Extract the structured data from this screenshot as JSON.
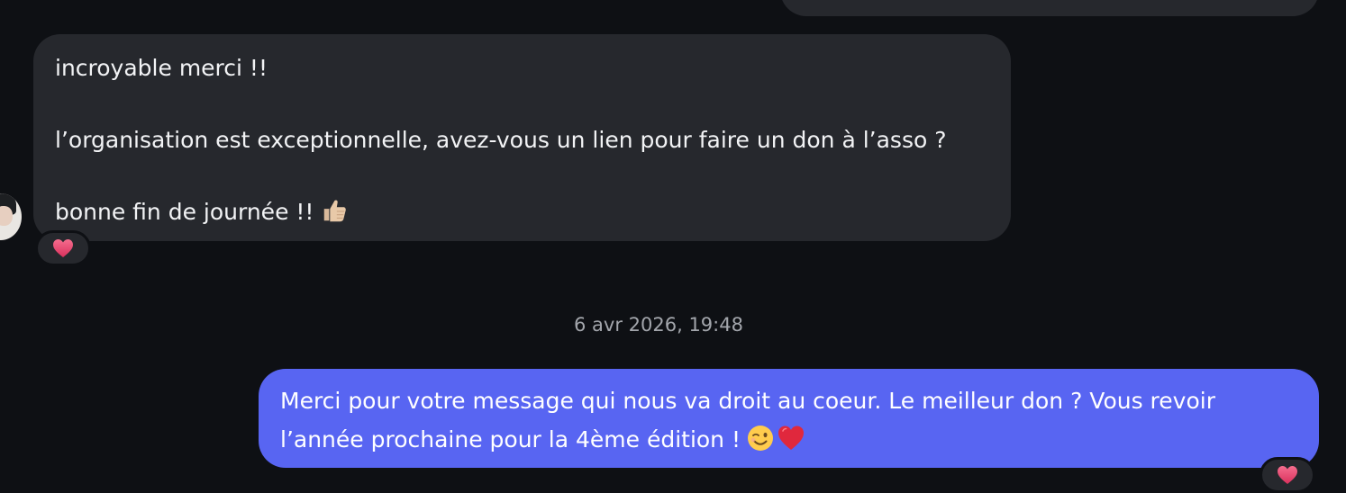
{
  "conversation": {
    "incoming_message": {
      "line1": "incroyable merci !!",
      "line2": "l’organisation est exceptionnelle, avez-vous un lien pour faire un don à l’asso ?",
      "line3": "bonne fin de journée !!",
      "emoji": "thumbs-up-icon",
      "reaction": "heart-icon"
    },
    "timestamp": "6 avr 2026, 19:48",
    "outgoing_message": {
      "line1": "Merci pour votre message qui nous va droit au coeur. Le meilleur don ? Vous revoir",
      "line2": "l’année prochaine pour la 4ème édition !",
      "emojis": [
        "wink-icon",
        "heart-icon"
      ],
      "reaction": "heart-icon"
    }
  },
  "colors": {
    "background": "#0e1014",
    "incoming_bubble": "#26282d",
    "outgoing_bubble": "#5865f2",
    "timestamp_text": "#a3a6ac",
    "reaction_heart": "#ec4a74"
  }
}
